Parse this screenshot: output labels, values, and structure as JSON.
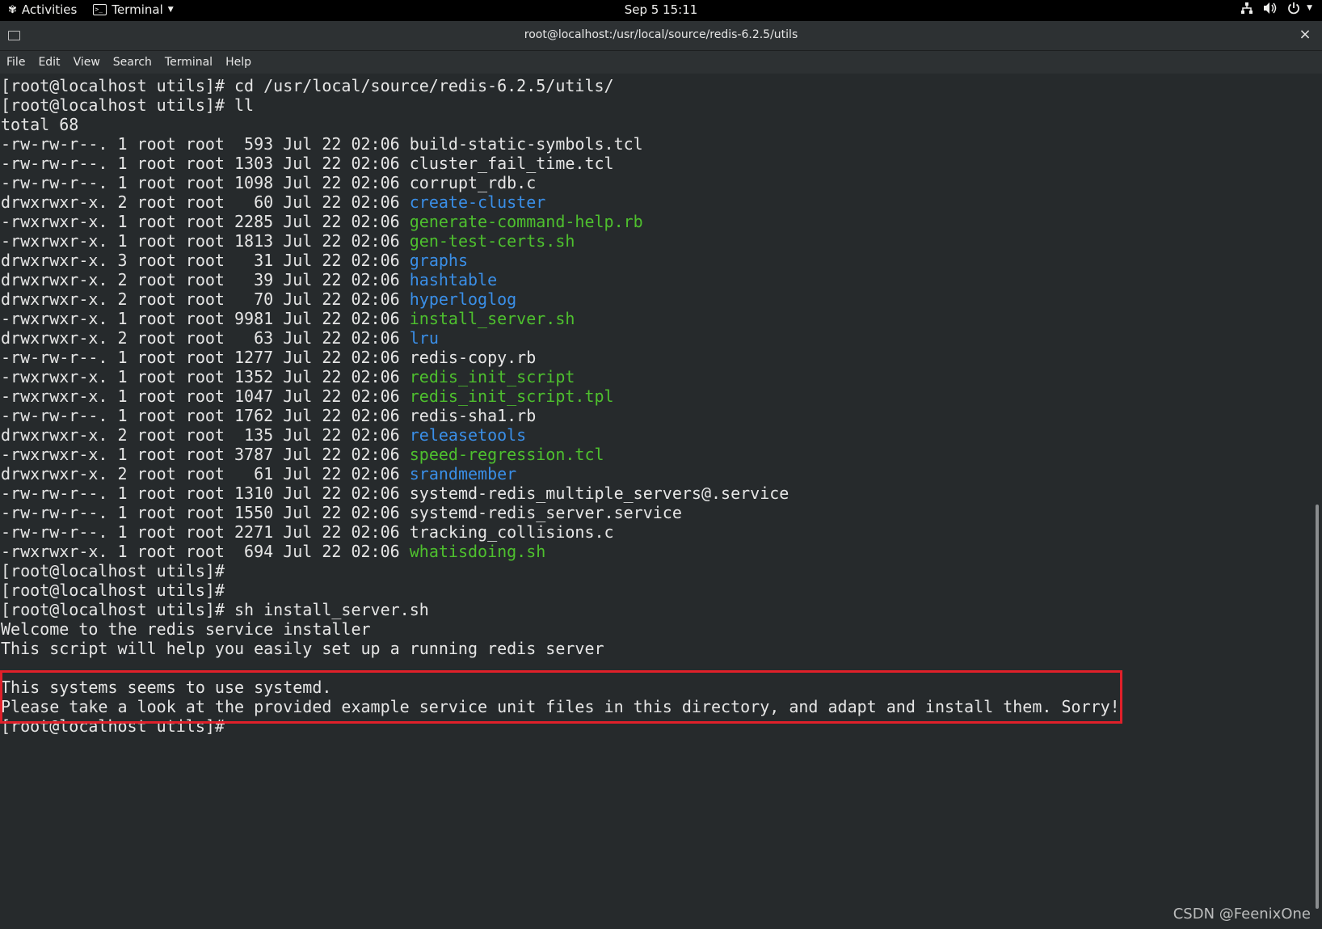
{
  "topbar": {
    "activities": "Activities",
    "app_menu": "Terminal",
    "clock": "Sep 5  15:11"
  },
  "window": {
    "title": "root@localhost:/usr/local/source/redis-6.2.5/utils",
    "close": "×"
  },
  "menu": [
    "File",
    "Edit",
    "View",
    "Search",
    "Terminal",
    "Help"
  ],
  "terminal_lines": [
    {
      "prefix": "[root@localhost utils]# cd /usr/local/source/redis-6.2.5/utils/",
      "name": "",
      "type": "default"
    },
    {
      "prefix": "[root@localhost utils]# ll",
      "name": "",
      "type": "default"
    },
    {
      "prefix": "total 68",
      "name": "",
      "type": "default"
    },
    {
      "prefix": "-rw-rw-r--. 1 root root  593 Jul 22 02:06 ",
      "name": "build-static-symbols.tcl",
      "type": "default"
    },
    {
      "prefix": "-rw-rw-r--. 1 root root 1303 Jul 22 02:06 ",
      "name": "cluster_fail_time.tcl",
      "type": "default"
    },
    {
      "prefix": "-rw-rw-r--. 1 root root 1098 Jul 22 02:06 ",
      "name": "corrupt_rdb.c",
      "type": "default"
    },
    {
      "prefix": "drwxrwxr-x. 2 root root   60 Jul 22 02:06 ",
      "name": "create-cluster",
      "type": "dir"
    },
    {
      "prefix": "-rwxrwxr-x. 1 root root 2285 Jul 22 02:06 ",
      "name": "generate-command-help.rb",
      "type": "exec"
    },
    {
      "prefix": "-rwxrwxr-x. 1 root root 1813 Jul 22 02:06 ",
      "name": "gen-test-certs.sh",
      "type": "exec"
    },
    {
      "prefix": "drwxrwxr-x. 3 root root   31 Jul 22 02:06 ",
      "name": "graphs",
      "type": "dir"
    },
    {
      "prefix": "drwxrwxr-x. 2 root root   39 Jul 22 02:06 ",
      "name": "hashtable",
      "type": "dir"
    },
    {
      "prefix": "drwxrwxr-x. 2 root root   70 Jul 22 02:06 ",
      "name": "hyperloglog",
      "type": "dir"
    },
    {
      "prefix": "-rwxrwxr-x. 1 root root 9981 Jul 22 02:06 ",
      "name": "install_server.sh",
      "type": "exec"
    },
    {
      "prefix": "drwxrwxr-x. 2 root root   63 Jul 22 02:06 ",
      "name": "lru",
      "type": "dir"
    },
    {
      "prefix": "-rw-rw-r--. 1 root root 1277 Jul 22 02:06 ",
      "name": "redis-copy.rb",
      "type": "default"
    },
    {
      "prefix": "-rwxrwxr-x. 1 root root 1352 Jul 22 02:06 ",
      "name": "redis_init_script",
      "type": "exec"
    },
    {
      "prefix": "-rwxrwxr-x. 1 root root 1047 Jul 22 02:06 ",
      "name": "redis_init_script.tpl",
      "type": "exec"
    },
    {
      "prefix": "-rw-rw-r--. 1 root root 1762 Jul 22 02:06 ",
      "name": "redis-sha1.rb",
      "type": "default"
    },
    {
      "prefix": "drwxrwxr-x. 2 root root  135 Jul 22 02:06 ",
      "name": "releasetools",
      "type": "dir"
    },
    {
      "prefix": "-rwxrwxr-x. 1 root root 3787 Jul 22 02:06 ",
      "name": "speed-regression.tcl",
      "type": "exec"
    },
    {
      "prefix": "drwxrwxr-x. 2 root root   61 Jul 22 02:06 ",
      "name": "srandmember",
      "type": "dir"
    },
    {
      "prefix": "-rw-rw-r--. 1 root root 1310 Jul 22 02:06 ",
      "name": "systemd-redis_multiple_servers@.service",
      "type": "default"
    },
    {
      "prefix": "-rw-rw-r--. 1 root root 1550 Jul 22 02:06 ",
      "name": "systemd-redis_server.service",
      "type": "default"
    },
    {
      "prefix": "-rw-rw-r--. 1 root root 2271 Jul 22 02:06 ",
      "name": "tracking_collisions.c",
      "type": "default"
    },
    {
      "prefix": "-rwxrwxr-x. 1 root root  694 Jul 22 02:06 ",
      "name": "whatisdoing.sh",
      "type": "exec"
    },
    {
      "prefix": "[root@localhost utils]#",
      "name": "",
      "type": "default"
    },
    {
      "prefix": "[root@localhost utils]#",
      "name": "",
      "type": "default"
    },
    {
      "prefix": "[root@localhost utils]# sh install_server.sh",
      "name": "",
      "type": "default"
    },
    {
      "prefix": "Welcome to the redis service installer",
      "name": "",
      "type": "default"
    },
    {
      "prefix": "This script will help you easily set up a running redis server",
      "name": "",
      "type": "default"
    },
    {
      "prefix": "",
      "name": "",
      "type": "default"
    },
    {
      "prefix": "This systems seems to use systemd.",
      "name": "",
      "type": "default"
    },
    {
      "prefix": "Please take a look at the provided example service unit files in this directory, and adapt and install them. Sorry!",
      "name": "",
      "type": "default"
    },
    {
      "prefix": "[root@localhost utils]#",
      "name": "",
      "type": "default"
    }
  ],
  "colors": {
    "background": "#262a2c",
    "text": "#e6e6e6",
    "executable": "#4ec02e",
    "directory": "#3a8fe8",
    "highlight_border": "#e0202a"
  },
  "watermark": "CSDN @FeenixOne"
}
